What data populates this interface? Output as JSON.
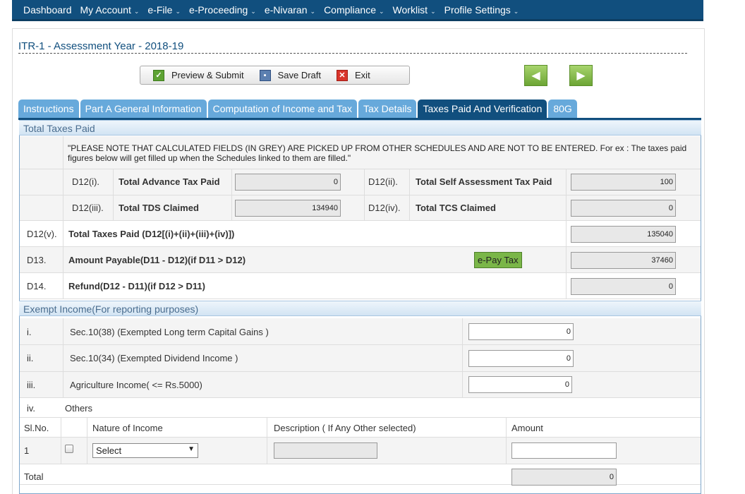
{
  "nav": {
    "items": [
      {
        "label": "Dashboard",
        "caret": false
      },
      {
        "label": "My Account",
        "caret": true
      },
      {
        "label": "e-File",
        "caret": true
      },
      {
        "label": "e-Proceeding",
        "caret": true
      },
      {
        "label": "e-Nivaran",
        "caret": true
      },
      {
        "label": "Compliance",
        "caret": true
      },
      {
        "label": "Worklist",
        "caret": true
      },
      {
        "label": "Profile Settings",
        "caret": true
      }
    ],
    "caret_glyph": "⌄"
  },
  "form_title": "ITR-1 - Assessment Year - 2018-19",
  "toolbar": {
    "preview_label": "Preview & Submit",
    "save_label": "Save Draft",
    "exit_label": "Exit"
  },
  "tabs": [
    {
      "label": "Instructions",
      "active": false
    },
    {
      "label": "Part A General Information",
      "active": false
    },
    {
      "label": "Computation of Income and Tax",
      "active": false
    },
    {
      "label": "Tax Details",
      "active": false
    },
    {
      "label": "Taxes Paid And Verification",
      "active": true
    },
    {
      "label": "80G",
      "active": false
    }
  ],
  "total_taxes_paid": {
    "header": "Total Taxes Paid",
    "note": "\"PLEASE NOTE THAT CALCULATED FIELDS (IN GREY) ARE PICKED UP FROM OTHER SCHEDULES AND ARE NOT TO BE ENTERED. For ex : The taxes paid figures below will get filled up when the Schedules linked to them are filled.\"",
    "d12i": {
      "code": "D12(i).",
      "label": "Total Advance Tax Paid",
      "value": "0"
    },
    "d12ii": {
      "code": "D12(ii).",
      "label": "Total Self Assessment Tax Paid",
      "value": "100"
    },
    "d12iii": {
      "code": "D12(iii).",
      "label": "Total TDS Claimed",
      "value": "134940"
    },
    "d12iv": {
      "code": "D12(iv).",
      "label": "Total TCS Claimed",
      "value": "0"
    },
    "d12v": {
      "code": "D12(v).",
      "label": "Total Taxes Paid (D12[(i)+(ii)+(iii)+(iv)])",
      "value": "135040"
    },
    "d13": {
      "code": "D13.",
      "label": "Amount Payable(D11 - D12)(if D11 > D12)",
      "value": "37460",
      "button": "e-Pay Tax"
    },
    "d14": {
      "code": "D14.",
      "label": "Refund(D12 - D11)(if D12 > D11)",
      "value": "0"
    }
  },
  "exempt_income": {
    "header": "Exempt Income(For reporting purposes)",
    "rows": [
      {
        "code": "i.",
        "label": "Sec.10(38) (Exempted Long term Capital Gains )",
        "value": "0"
      },
      {
        "code": "ii.",
        "label": "Sec.10(34) (Exempted Dividend Income )",
        "value": "0"
      },
      {
        "code": "iii.",
        "label": "Agriculture Income( <= Rs.5000)",
        "value": "0"
      }
    ],
    "others": {
      "code": "iv.",
      "label": "Others"
    },
    "table": {
      "headers": {
        "slno": "Sl.No.",
        "nature": "Nature of Income",
        "description": "Description ( If Any Other selected)",
        "amount": "Amount"
      },
      "row": {
        "slno": "1",
        "select_value": "Select",
        "description": "",
        "amount": ""
      }
    },
    "total": {
      "label": "Total",
      "value": "0"
    }
  }
}
